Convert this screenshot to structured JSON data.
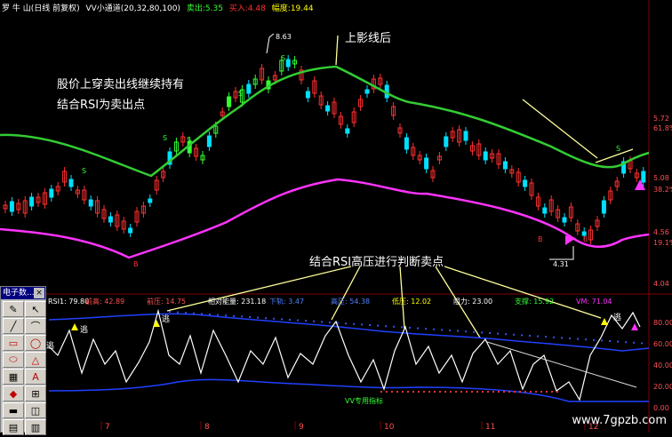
{
  "header": {
    "stock": "罗 牛 山(日线 前复权)",
    "indicator": "VV小通道(20,32,80,100)",
    "sell_label": "卖出:",
    "sell_value": "5.35",
    "buy_label": "买入:",
    "buy_value": "4.48",
    "amp_label": "幅度:",
    "amp_value": "19.44"
  },
  "annotations": {
    "top_left_line1": "股价上穿卖出线继续持有",
    "top_left_line2": "结合RSI为卖出点",
    "top_mid": "上影线后",
    "lower_mid": "结合RSI高压进行判断卖点",
    "high_point": "8.63",
    "low_point": "4.31",
    "vv_label": "VV专用指标"
  },
  "price_axis": [
    "5.72",
    "61.8%",
    "5.08",
    "38.2%",
    "4.56",
    "19.1%",
    "4.04"
  ],
  "indicator_bar": {
    "rsi": "RSI1: 79.80",
    "items": [
      "前高: 42.89",
      "前压: 14.75",
      "相对能量: 231.18",
      "下轨: 3.47",
      "高压: 54.38",
      "低压: 12.02",
      "阻力: 23.00",
      "支撑: 15.92",
      "VM: 71.04"
    ]
  },
  "indicator_axis": [
    "80.00",
    "60.00",
    "40.00",
    "20.00",
    "0.00"
  ],
  "date_axis": [
    "7",
    "8",
    "9",
    "10",
    "11",
    "12"
  ],
  "palette": {
    "title": "电子数...",
    "close": "×",
    "tools": [
      "✎",
      "↖",
      "╱",
      "⌒",
      "▭",
      "◯",
      "⬭",
      "△",
      "▦",
      "A",
      "◆",
      "⊞",
      "▬",
      "◫",
      "▤",
      "▥"
    ]
  },
  "watermark": "www.7gpzb.com",
  "colors": {
    "up": "#ff3030",
    "down": "#00e0ff",
    "green_band": "#33cc33",
    "magenta_band": "#ff33ff",
    "label_yellow": "#ffff00"
  }
}
